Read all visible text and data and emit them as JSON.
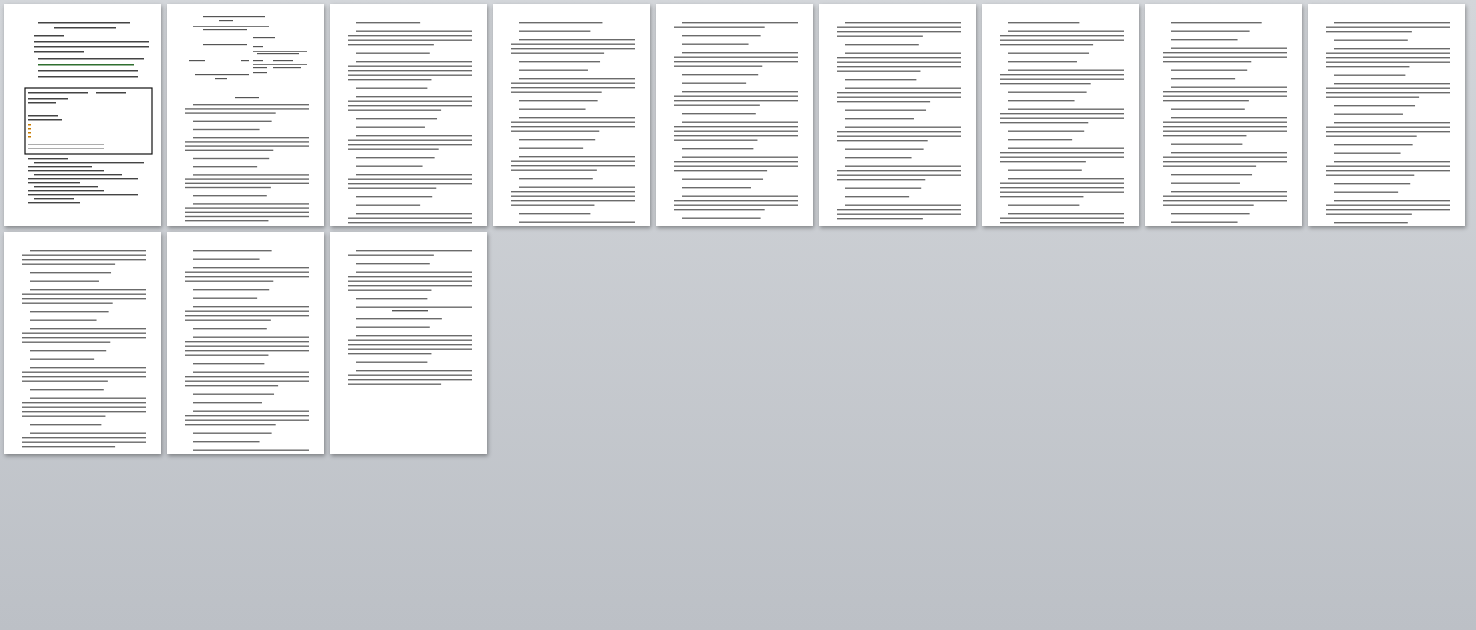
{
  "pages": [
    {
      "kind": "cover"
    },
    {
      "kind": "form"
    },
    {
      "kind": "text"
    },
    {
      "kind": "text"
    },
    {
      "kind": "text"
    },
    {
      "kind": "text"
    },
    {
      "kind": "text"
    },
    {
      "kind": "text"
    },
    {
      "kind": "text"
    },
    {
      "kind": "text"
    },
    {
      "kind": "text"
    },
    {
      "kind": "end"
    }
  ]
}
